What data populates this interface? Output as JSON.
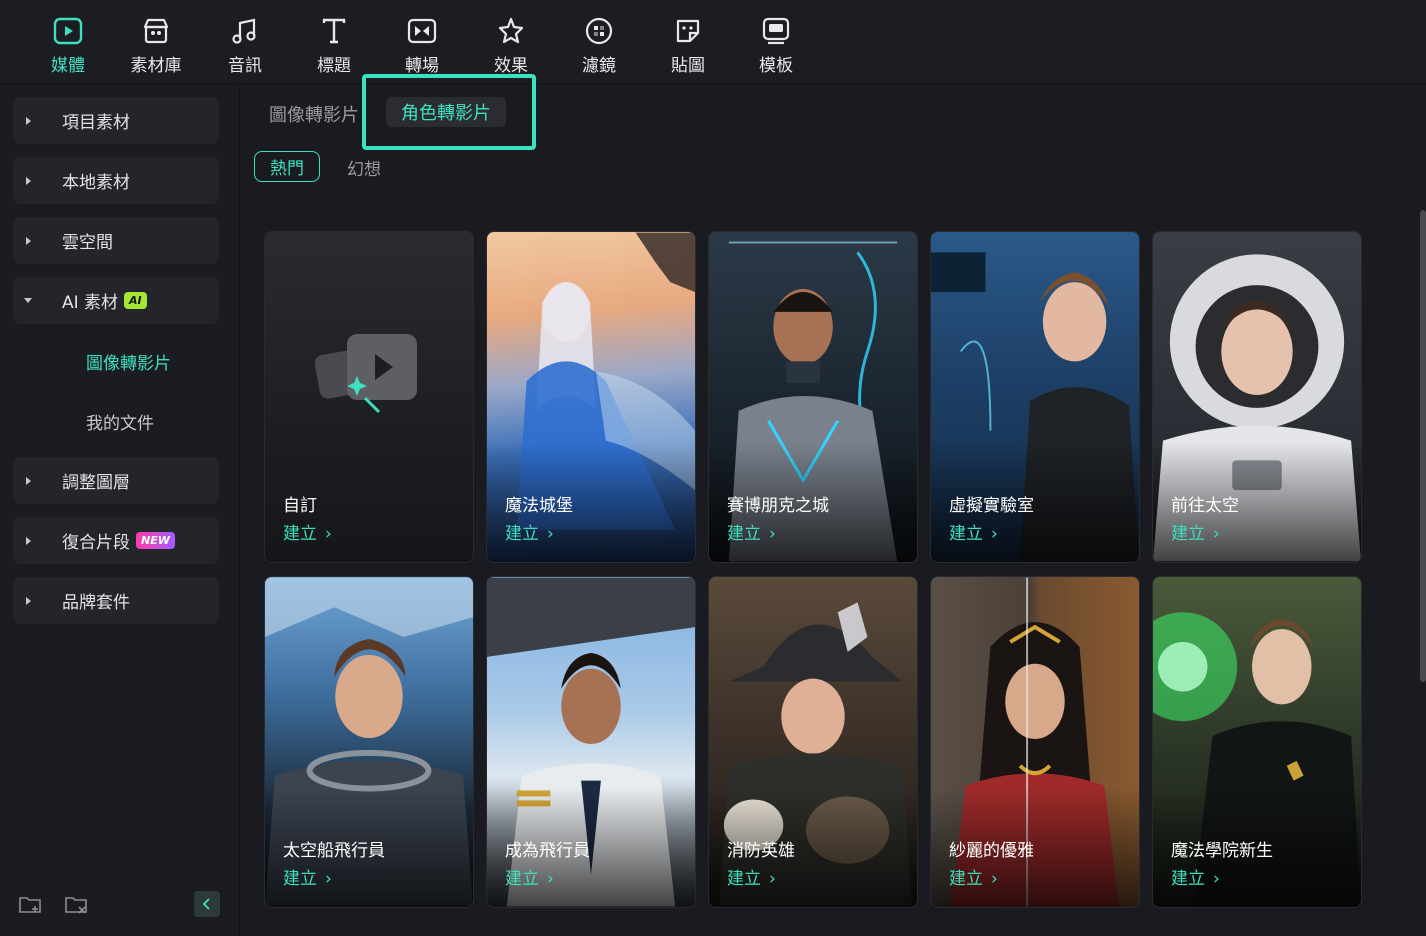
{
  "toolbar": {
    "items": [
      {
        "label": "媒體",
        "icon": "media-icon",
        "active": true
      },
      {
        "label": "素材庫",
        "icon": "stock-library-icon",
        "active": false
      },
      {
        "label": "音訊",
        "icon": "music-note-icon",
        "active": false
      },
      {
        "label": "標題",
        "icon": "title-t-icon",
        "active": false
      },
      {
        "label": "轉場",
        "icon": "transition-icon",
        "active": false
      },
      {
        "label": "效果",
        "icon": "effects-icon",
        "active": false
      },
      {
        "label": "濾鏡",
        "icon": "filter-icon",
        "active": false
      },
      {
        "label": "貼圖",
        "icon": "sticker-icon",
        "active": false
      },
      {
        "label": "模板",
        "icon": "template-icon",
        "active": false
      }
    ]
  },
  "sidebar": {
    "items": [
      {
        "label": "項目素材",
        "expanded": false
      },
      {
        "label": "本地素材",
        "expanded": false
      },
      {
        "label": "雲空間",
        "expanded": false
      },
      {
        "label": "AI 素材",
        "expanded": true,
        "badge": "AI"
      },
      {
        "label": "調整圖層",
        "expanded": false
      },
      {
        "label": "復合片段",
        "expanded": false,
        "badge": "NEW"
      },
      {
        "label": "品牌套件",
        "expanded": false
      }
    ],
    "subitems": [
      {
        "label": "圖像轉影片",
        "active": true
      },
      {
        "label": "我的文件",
        "active": false
      }
    ]
  },
  "main": {
    "tabs": [
      {
        "label": "圖像轉影片",
        "active": false
      },
      {
        "label": "角色轉影片",
        "active": true
      }
    ],
    "chips": [
      {
        "label": "熱門",
        "active": true
      },
      {
        "label": "幻想",
        "active": false
      }
    ],
    "create_label": "建立",
    "cards": [
      {
        "title": "自訂"
      },
      {
        "title": "魔法城堡"
      },
      {
        "title": "賽博朋克之城"
      },
      {
        "title": "虛擬實驗室"
      },
      {
        "title": "前往太空"
      },
      {
        "title": "太空船飛行員"
      },
      {
        "title": "成為飛行員"
      },
      {
        "title": "消防英雄"
      },
      {
        "title": "紗麗的優雅"
      },
      {
        "title": "魔法學院新生"
      }
    ]
  },
  "colors": {
    "accent": "#3fe0c0",
    "background": "#1a1b20",
    "panel": "#24252b"
  }
}
